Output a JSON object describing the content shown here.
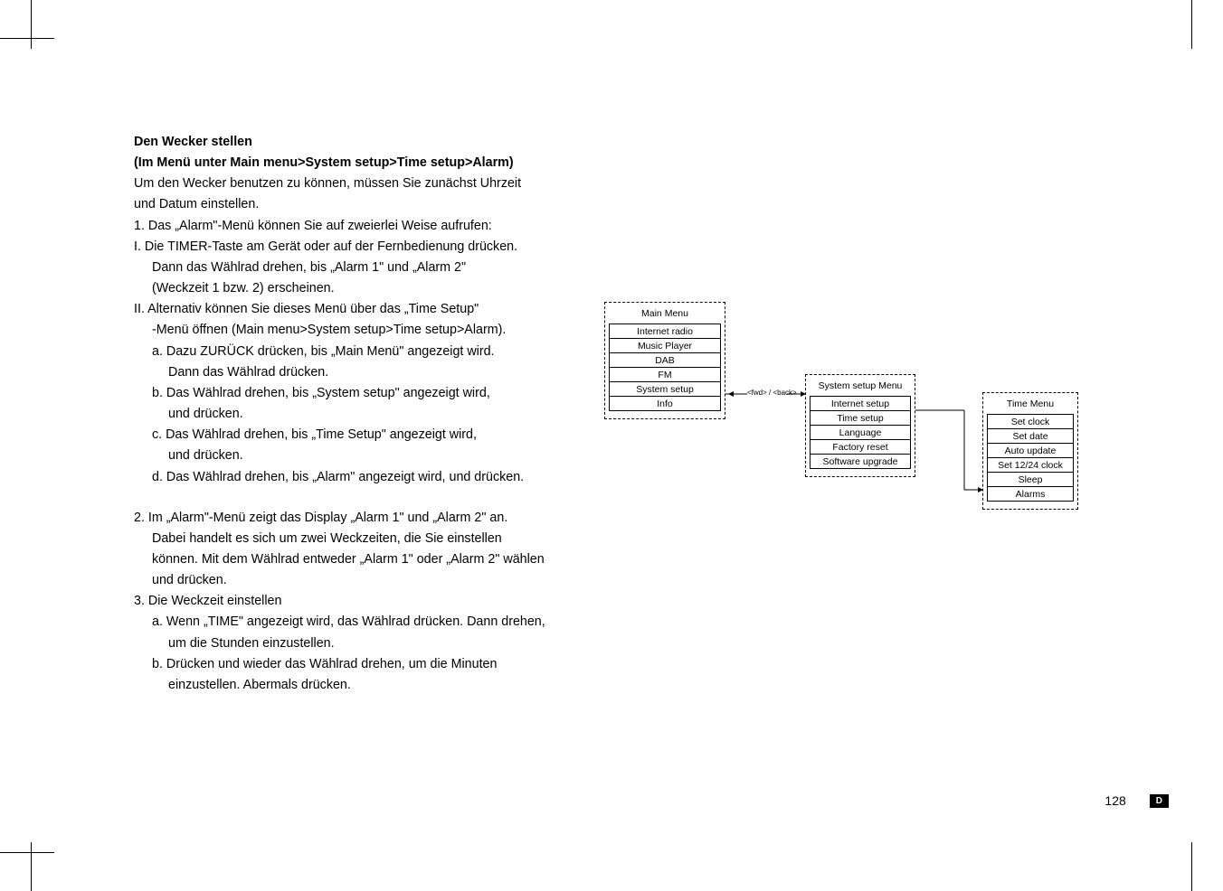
{
  "text": {
    "heading1": "Den Wecker stellen",
    "heading2": "(Im Menü unter Main menu>System setup>Time setup>Alarm)",
    "p1": "Um den Wecker benutzen zu können, müssen Sie zunächst Uhrzeit",
    "p2": "und Datum einstellen.",
    "l1": "1. Das „Alarm\"-Menü können Sie auf zweierlei Weise aufrufen:",
    "l2": "I.  Die TIMER-Taste am Gerät oder auf der Fernbedienung drücken.",
    "l2a": "Dann das Wählrad drehen, bis „Alarm 1\" und „Alarm 2\"",
    "l2b": " (Weckzeit 1 bzw. 2) erscheinen.",
    "l3": "II. Alternativ können Sie dieses Menü über das „Time Setup\"",
    "l3a": "-Menü öffnen (Main menu>System setup>Time setup>Alarm).",
    "l4": "a. Dazu ZURÜCK drücken, bis „Main Menü\" angezeigt wird.",
    "l4a": "Dann das Wählrad drücken.",
    "l5": "b. Das Wählrad drehen, bis „System setup\" angezeigt wird,",
    "l5a": " und drücken.",
    "l6": "c. Das Wählrad drehen, bis „Time Setup\" angezeigt wird,",
    "l6a": "und drücken.",
    "l7": "d. Das Wählrad drehen, bis „Alarm\" angezeigt wird, und drücken.",
    "l8": "2. Im „Alarm\"-Menü zeigt das Display „Alarm 1\" und „Alarm 2\" an.",
    "l8a": "Dabei handelt es sich um zwei Weckzeiten, die Sie einstellen",
    "l8b": "können. Mit dem Wählrad entweder „Alarm 1\" oder „Alarm 2\" wählen",
    "l8c": "und drücken.",
    "l9": "3. Die Weckzeit einstellen",
    "l10": "a. Wenn „TIME\" angezeigt wird, das Wählrad drücken. Dann drehen,",
    "l10a": " um die Stunden einzustellen.",
    "l11": "b. Drücken und wieder das Wählrad drehen, um die Minuten",
    "l11a": " einzustellen. Abermals drücken."
  },
  "diagram": {
    "fwdback": "<fwd> / <back>",
    "main": {
      "title": "Main Menu",
      "items": [
        "Internet radio",
        "Music Player",
        "DAB",
        "FM",
        "System setup",
        "Info"
      ]
    },
    "system": {
      "title": "System setup Menu",
      "items": [
        "Internet setup",
        "Time setup",
        "Language",
        "Factory reset",
        "Software upgrade"
      ]
    },
    "time": {
      "title": "Time Menu",
      "items": [
        "Set clock",
        "Set date",
        "Auto update",
        "Set 12/24 clock",
        "Sleep",
        "Alarms"
      ]
    }
  },
  "footer": {
    "page": "128",
    "lang": "D"
  }
}
